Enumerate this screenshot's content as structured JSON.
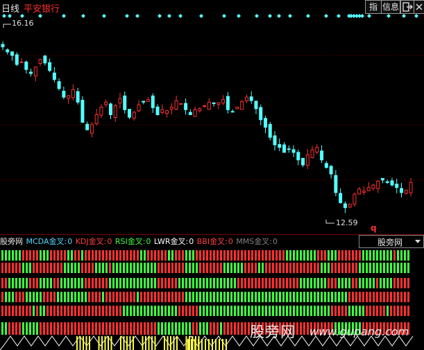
{
  "window": {
    "period": "日线",
    "stock_name": "平安银行",
    "buttons": {
      "index": "指",
      "info": "信息",
      "exit_icon": "exit-icon",
      "close_icon": "close-x-icon"
    }
  },
  "price_panel": {
    "max_label": "16.16",
    "min_label": "12.59",
    "marker": "q",
    "colors": {
      "up": "#ff3030",
      "down": "#54ffff",
      "signal": "#54ffff",
      "grid": "#8b0000"
    }
  },
  "indicator": {
    "name": "股旁网",
    "rows": [
      {
        "label": "MCDA金叉:",
        "value": "0",
        "color": "#54d8ff"
      },
      {
        "label": "KDJ金叉:",
        "value": "0",
        "color": "#ff4040"
      },
      {
        "label": "RSI金叉:",
        "value": "0",
        "color": "#40ff40"
      },
      {
        "label": "LWR金叉:",
        "value": "0",
        "color": "#ffffff"
      },
      {
        "label": "BBI金叉:",
        "value": "0",
        "color": "#ff4040"
      },
      {
        "label": "MMS金叉:",
        "value": "0",
        "color": "#808080"
      }
    ],
    "colors": {
      "green": "#40ff40",
      "red": "#ff3030",
      "yellow": "#ffff40",
      "white": "#ffffff"
    },
    "selector_label": "股旁网"
  },
  "watermark": {
    "cn": "股旁网",
    "url": "www.gupang.com"
  },
  "chart_data": {
    "type": "candlestick",
    "price_range": [
      12.4,
      16.4
    ],
    "max_price": 16.16,
    "min_price": 12.59,
    "close_series": [
      15.95,
      15.85,
      15.78,
      15.6,
      15.65,
      15.5,
      15.42,
      15.55,
      15.7,
      15.63,
      15.48,
      15.3,
      15.12,
      14.95,
      14.98,
      15.1,
      14.85,
      14.45,
      14.3,
      14.4,
      14.6,
      14.75,
      14.85,
      14.6,
      14.78,
      14.92,
      14.7,
      14.55,
      14.65,
      14.8,
      14.85,
      14.9,
      14.74,
      14.6,
      14.7,
      14.68,
      14.75,
      14.88,
      14.82,
      14.7,
      14.6,
      14.7,
      14.72,
      14.78,
      14.85,
      14.82,
      14.84,
      14.9,
      14.7,
      14.66,
      14.75,
      14.86,
      14.95,
      14.88,
      14.72,
      14.5,
      14.35,
      14.15,
      14.0,
      13.95,
      13.85,
      13.92,
      13.85,
      13.7,
      13.6,
      13.8,
      13.9,
      13.95,
      13.7,
      13.55,
      13.42,
      13.05,
      12.85,
      12.75,
      12.82,
      13.02,
      13.12,
      13.08,
      13.15,
      13.2,
      13.28,
      13.3,
      13.25,
      13.2,
      13.15,
      13.05,
      13.1,
      13.25
    ]
  }
}
